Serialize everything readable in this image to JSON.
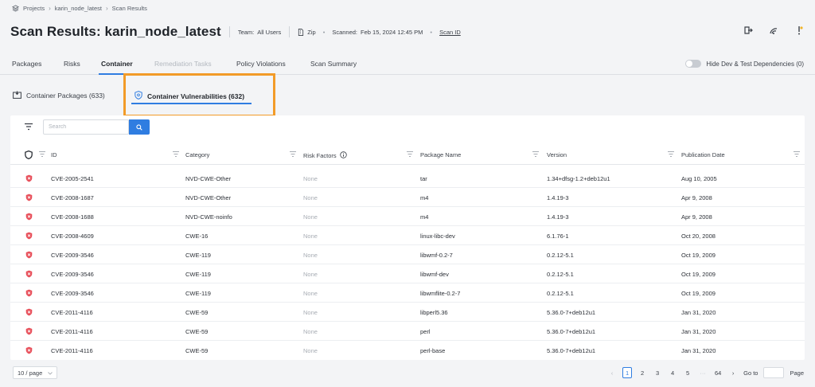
{
  "breadcrumb": [
    "Projects",
    "karin_node_latest",
    "Scan Results"
  ],
  "header": {
    "title": "Scan Results: karin_node_latest",
    "team_label": "Team:",
    "team_value": "All Users",
    "type": "Zip",
    "scanned_label": "Scanned:",
    "scanned_value": "Feb 15, 2024 12:45 PM",
    "scan_id_link": "Scan ID"
  },
  "tabs": [
    "Packages",
    "Risks",
    "Container",
    "Remediation Tasks",
    "Policy Violations",
    "Scan Summary"
  ],
  "toggle_label": "Hide Dev & Test Dependencies (0)",
  "subtabs": [
    "Container Packages (633)",
    "Container Vulnerabilities (632)"
  ],
  "search": {
    "placeholder": "Search"
  },
  "columns": [
    "ID",
    "Category",
    "Risk Factors",
    "Package Name",
    "Version",
    "Publication Date"
  ],
  "rows": [
    {
      "id": "CVE-2005-2541",
      "category": "NVD-CWE-Other",
      "risk": "None",
      "package": "tar",
      "version": "1.34+dfsg-1.2+deb12u1",
      "date": "Aug 10, 2005"
    },
    {
      "id": "CVE-2008-1687",
      "category": "NVD-CWE-Other",
      "risk": "None",
      "package": "m4",
      "version": "1.4.19-3",
      "date": "Apr 9, 2008"
    },
    {
      "id": "CVE-2008-1688",
      "category": "NVD-CWE-noinfo",
      "risk": "None",
      "package": "m4",
      "version": "1.4.19-3",
      "date": "Apr 9, 2008"
    },
    {
      "id": "CVE-2008-4609",
      "category": "CWE-16",
      "risk": "None",
      "package": "linux-libc-dev",
      "version": "6.1.76-1",
      "date": "Oct 20, 2008"
    },
    {
      "id": "CVE-2009-3546",
      "category": "CWE-119",
      "risk": "None",
      "package": "libwmf-0.2-7",
      "version": "0.2.12-5.1",
      "date": "Oct 19, 2009"
    },
    {
      "id": "CVE-2009-3546",
      "category": "CWE-119",
      "risk": "None",
      "package": "libwmf-dev",
      "version": "0.2.12-5.1",
      "date": "Oct 19, 2009"
    },
    {
      "id": "CVE-2009-3546",
      "category": "CWE-119",
      "risk": "None",
      "package": "libwmflite-0.2-7",
      "version": "0.2.12-5.1",
      "date": "Oct 19, 2009"
    },
    {
      "id": "CVE-2011-4116",
      "category": "CWE-59",
      "risk": "None",
      "package": "libperl5.36",
      "version": "5.36.0-7+deb12u1",
      "date": "Jan 31, 2020"
    },
    {
      "id": "CVE-2011-4116",
      "category": "CWE-59",
      "risk": "None",
      "package": "perl",
      "version": "5.36.0-7+deb12u1",
      "date": "Jan 31, 2020"
    },
    {
      "id": "CVE-2011-4116",
      "category": "CWE-59",
      "risk": "None",
      "package": "perl-base",
      "version": "5.36.0-7+deb12u1",
      "date": "Jan 31, 2020"
    }
  ],
  "pagination": {
    "page_size": "10 / page",
    "pages": [
      "1",
      "2",
      "3",
      "4",
      "5",
      "···",
      "64"
    ],
    "current": "1",
    "goto_label": "Go to",
    "page_label": "Page"
  },
  "colors": {
    "accent": "#2f7de1",
    "highlight": "#f29b28",
    "severity": "#e8505b"
  }
}
